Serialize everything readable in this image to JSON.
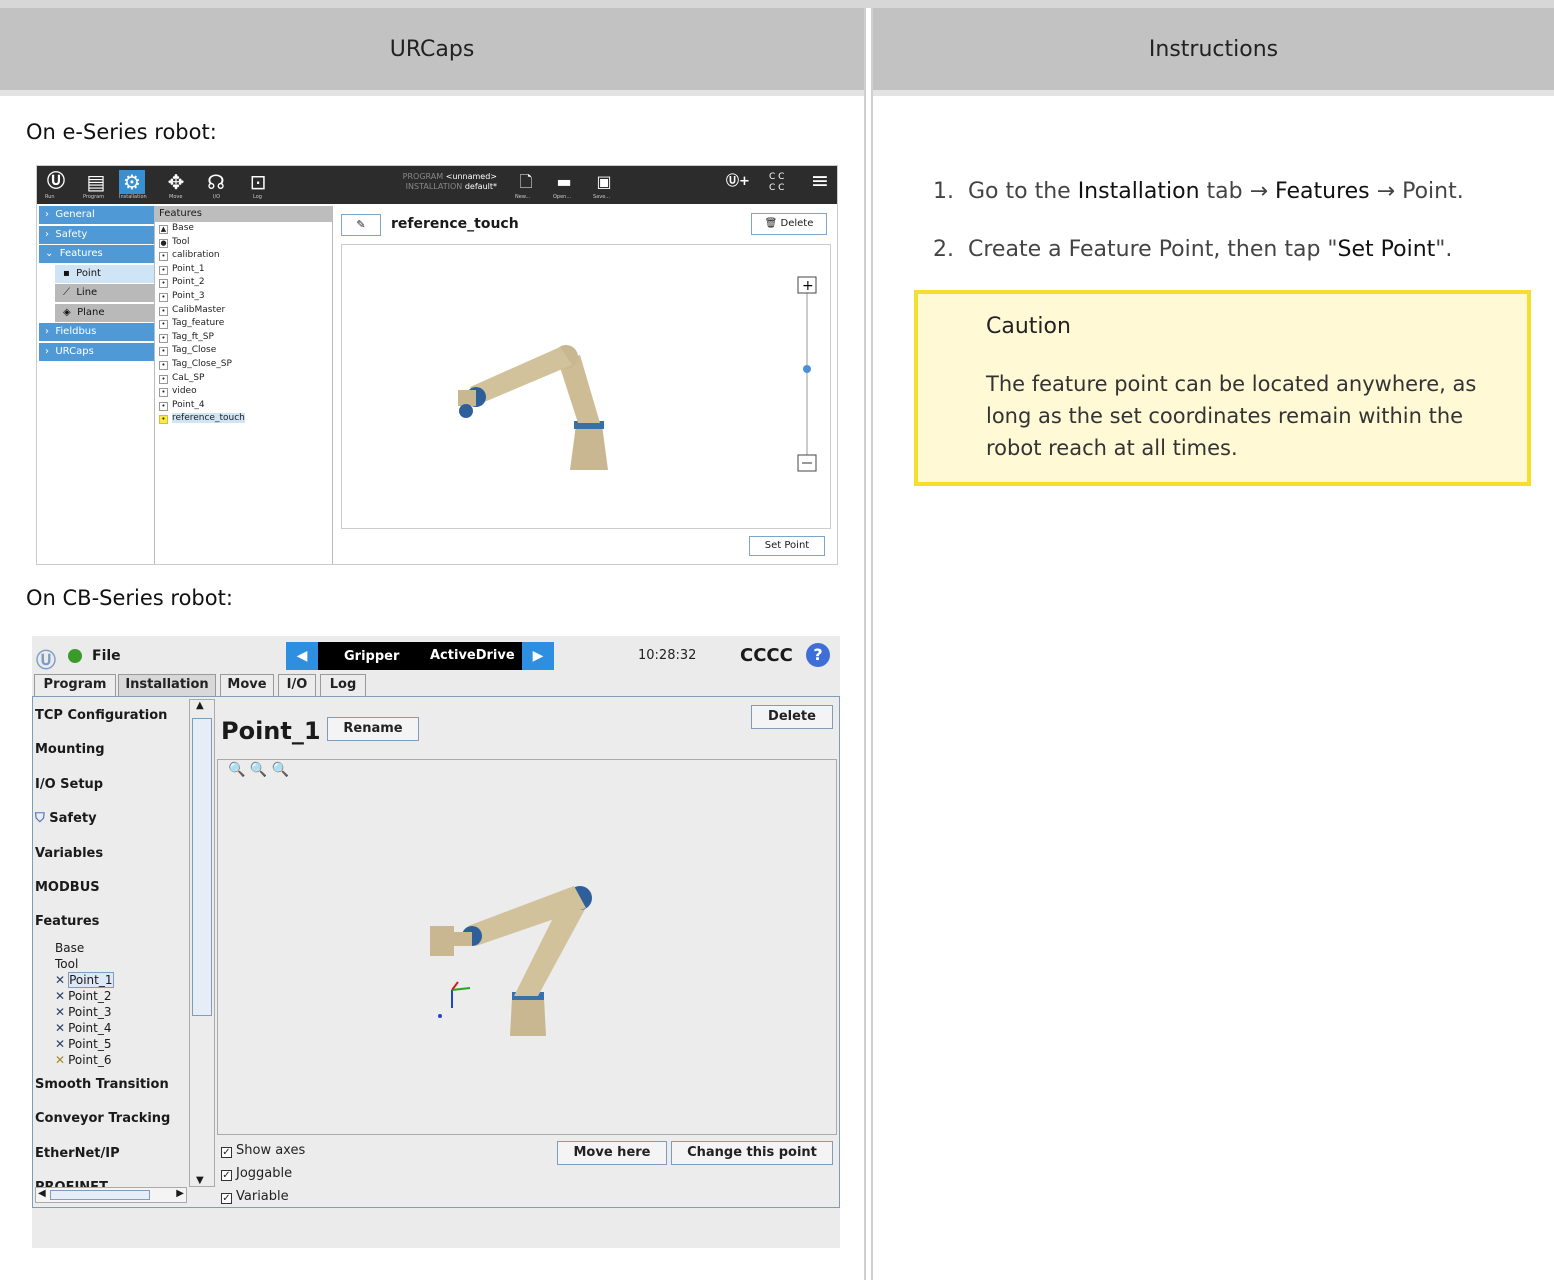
{
  "header": {
    "left": "URCaps",
    "right": "Instructions"
  },
  "labels": {
    "eseries": "On e-Series robot:",
    "cbseries": "On CB-Series robot:"
  },
  "eseries": {
    "toolbar": {
      "run": "Run",
      "program": "Program",
      "installation": "Installation",
      "move": "Move",
      "io": "I/O",
      "log": "Log"
    },
    "program_label": "PROGRAM",
    "program_value": "<unnamed>",
    "installation_label": "INSTALLATION",
    "installation_value": "default*",
    "new": "New...",
    "open": "Open...",
    "save": "Save...",
    "cccc_top": "C C",
    "cccc_bottom": "C C",
    "nav": {
      "general": "General",
      "safety": "Safety",
      "features": "Features",
      "point": "Point",
      "line": "Line",
      "plane": "Plane",
      "fieldbus": "Fieldbus",
      "urcaps": "URCaps"
    },
    "features_header": "Features",
    "features": [
      "Base",
      "Tool",
      "calibration",
      "Point_1",
      "Point_2",
      "Point_3",
      "CalibMaster",
      "Tag_feature",
      "Tag_ft_SP",
      "Tag_Close",
      "Tag_Close_SP",
      "CaL_SP",
      "video",
      "Point_4",
      "reference_touch"
    ],
    "title": "reference_touch",
    "delete": "Delete",
    "set_point": "Set Point"
  },
  "cb": {
    "file": "File",
    "gripper": "Gripper",
    "activedrive": "ActiveDrive",
    "time": "10:28:32",
    "cccc": "CCCC",
    "help": "?",
    "tabs": [
      "Program",
      "Installation",
      "Move",
      "I/O",
      "Log"
    ],
    "side_items": [
      "TCP Configuration",
      "Mounting",
      "I/O Setup",
      "Safety",
      "Variables",
      "MODBUS",
      "Features"
    ],
    "features": [
      "Base",
      "Tool",
      "Point_1",
      "Point_2",
      "Point_3",
      "Point_4",
      "Point_5",
      "Point_6"
    ],
    "side_items_after": [
      "Smooth Transition",
      "Conveyor Tracking",
      "EtherNet/IP",
      "PROFINET"
    ],
    "title": "Point_1",
    "rename": "Rename",
    "delete": "Delete",
    "show_axes": "Show axes",
    "joggable": "Joggable",
    "variable": "Variable",
    "move_here": "Move here",
    "change_point": "Change this point"
  },
  "instructions": {
    "step1_num": "1.",
    "step1_a": "Go to the",
    "step1_installation": "Installation",
    "step1_b": "tab →",
    "step1_features": "Features",
    "step1_c": "→ Point.",
    "step2_num": "2.",
    "step2_a": "Create a Feature Point, then tap \"",
    "step2_setpoint": "Set Point",
    "step2_b": "\".",
    "caution_title": "Caution",
    "caution_text": "The feature point can be located anywhere, as long as the set coordinates remain within the robot reach at all times."
  }
}
